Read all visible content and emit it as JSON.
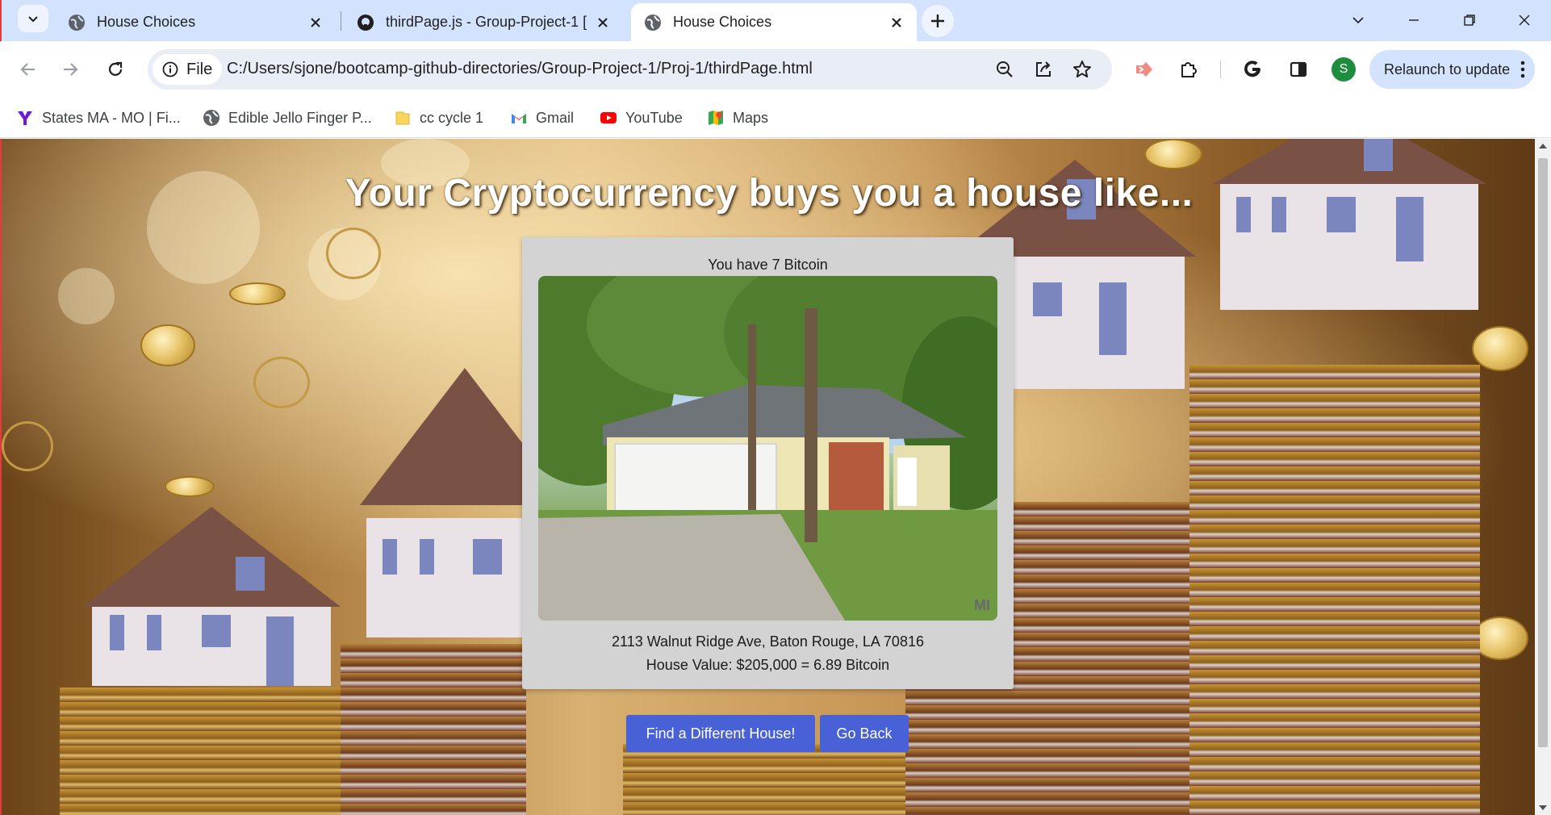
{
  "tabs": [
    {
      "title": "House Choices",
      "active": false
    },
    {
      "title": "thirdPage.js - Group-Project-1 [G",
      "active": false
    },
    {
      "title": "House Choices",
      "active": true
    }
  ],
  "address_bar": {
    "site_label": "File",
    "url": "C:/Users/sjone/bootcamp-github-directories/Group-Project-1/Proj-1/thirdPage.html"
  },
  "profile": {
    "initial": "S"
  },
  "relaunch_label": "Relaunch to update",
  "bookmarks": [
    {
      "label": "States MA - MO | Fi...",
      "icon": "yahoo-icon"
    },
    {
      "label": "Edible Jello Finger P...",
      "icon": "globe-icon"
    },
    {
      "label": "cc cycle 1",
      "icon": "folder-icon"
    },
    {
      "label": "Gmail",
      "icon": "gmail-icon"
    },
    {
      "label": "YouTube",
      "icon": "youtube-icon"
    },
    {
      "label": "Maps",
      "icon": "maps-icon"
    }
  ],
  "page": {
    "headline": "Your Cryptocurrency buys you a house like...",
    "bitcoin_owned": "You have 7 Bitcoin",
    "photo_watermark": "MI",
    "address": "2113 Walnut Ridge Ave, Baton Rouge, LA 70816",
    "house_value": "House Value: $205,000 = 6.89 Bitcoin",
    "find_button": "Find a Different House!",
    "back_button": "Go Back"
  },
  "colors": {
    "tab_strip": "#d3e3fd",
    "button": "#4861d6",
    "card": "#d3d3d3"
  }
}
